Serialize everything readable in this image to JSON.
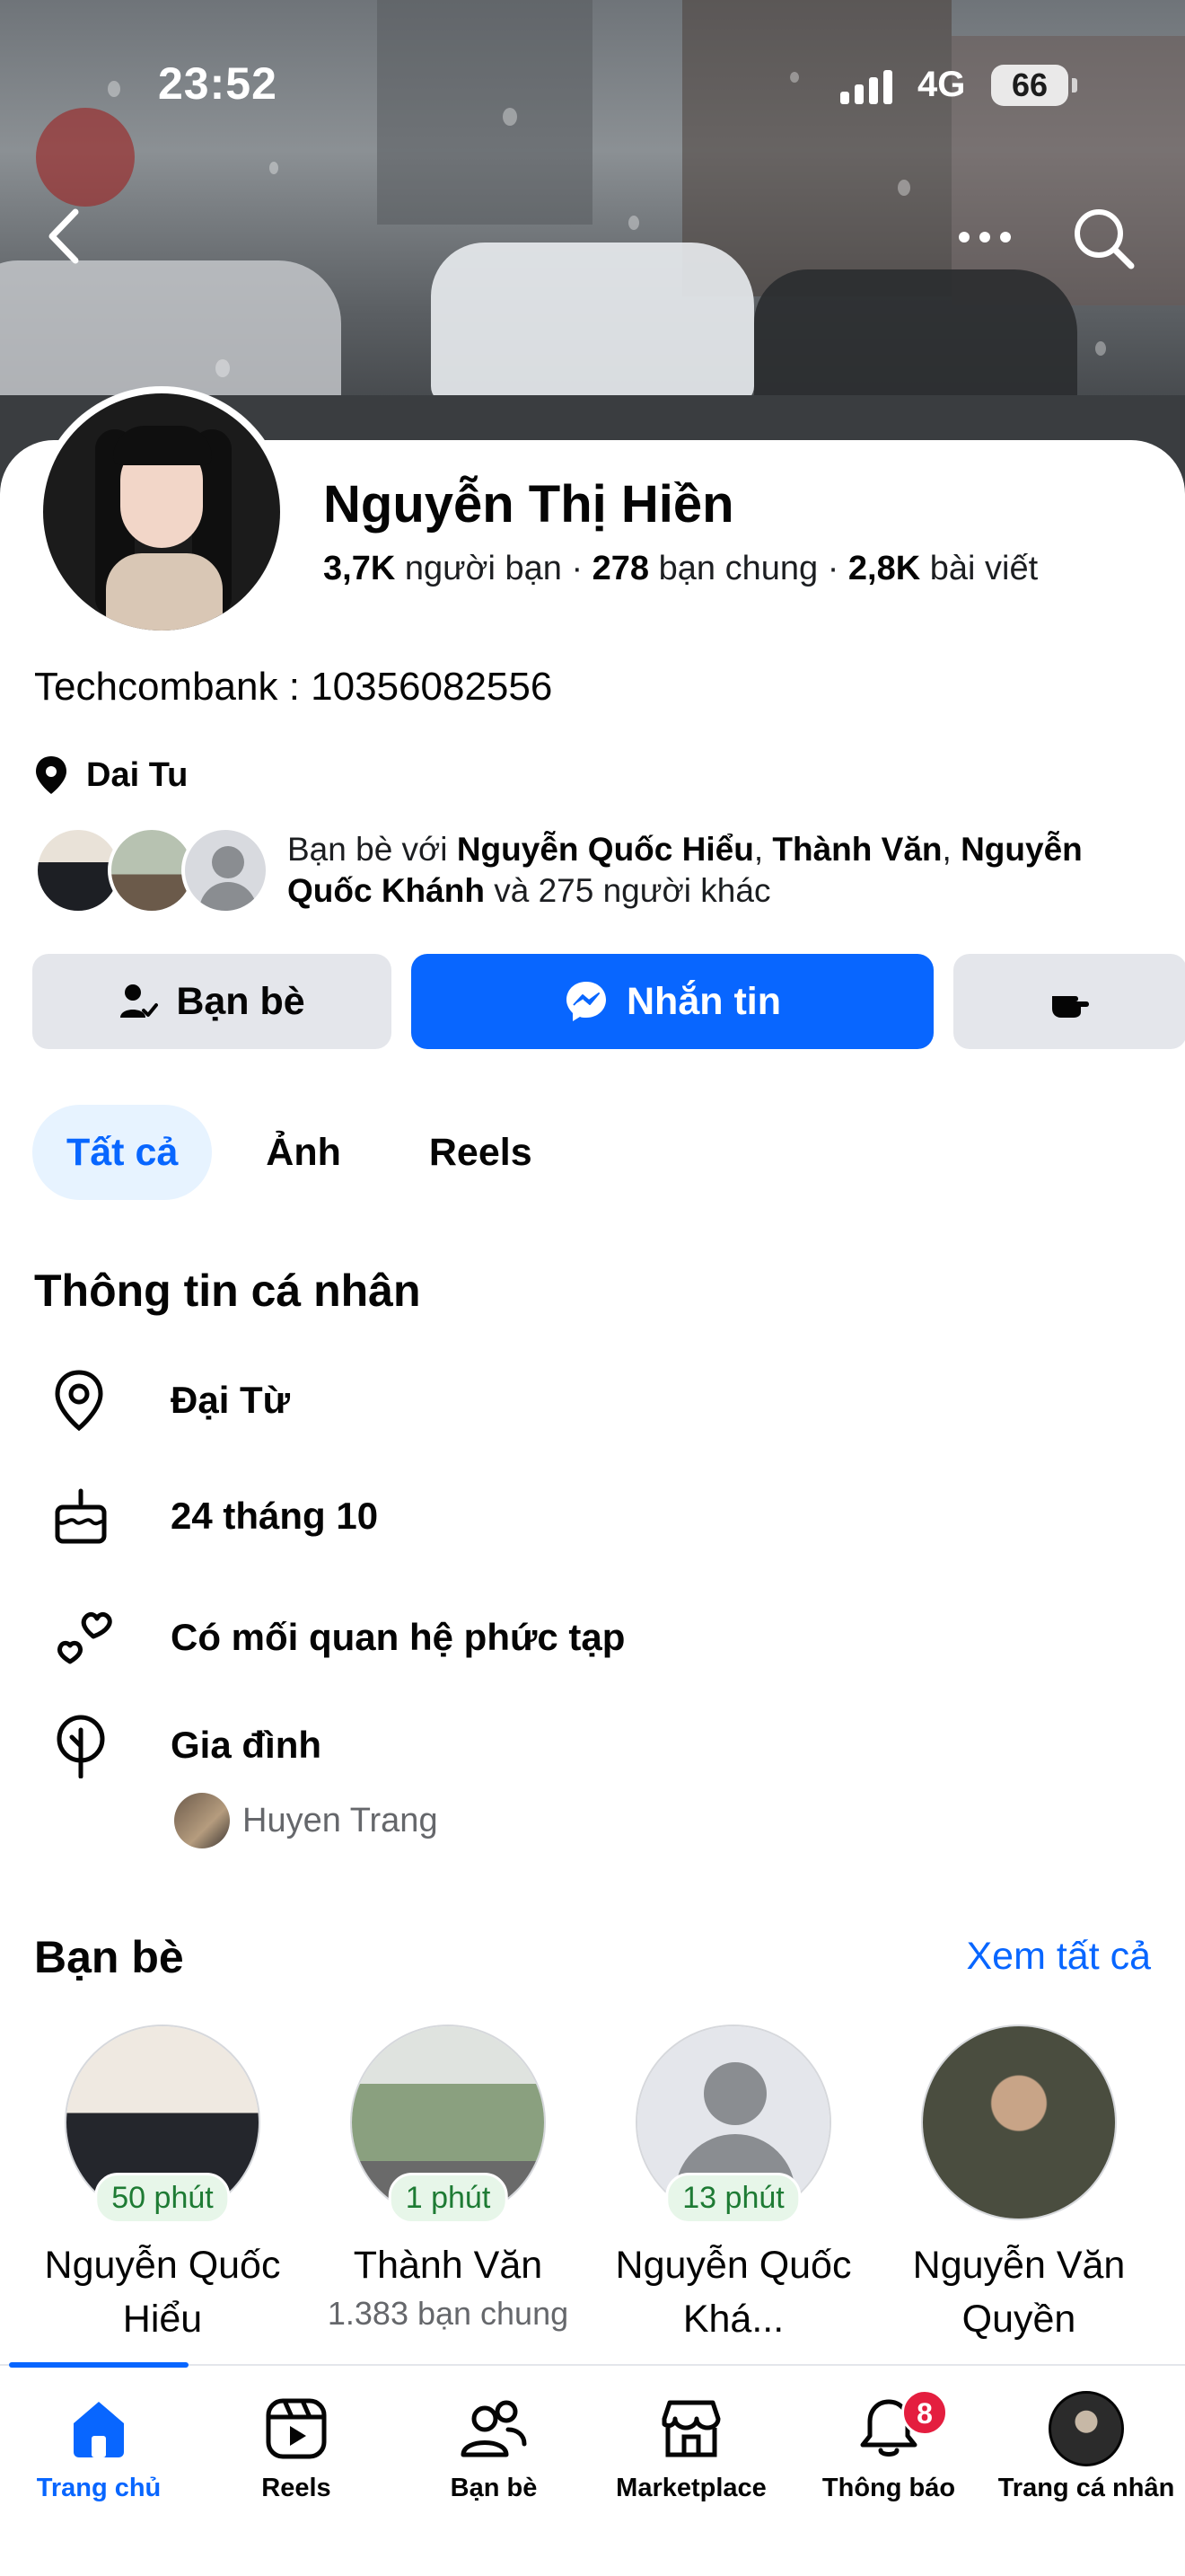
{
  "status_bar": {
    "time": "23:52",
    "network": "4G",
    "battery": "66"
  },
  "profile": {
    "name": "Nguyễn Thị Hiền",
    "stats": [
      {
        "value": "3,7K",
        "label": "người bạn"
      },
      {
        "value": "278",
        "label": "bạn chung"
      },
      {
        "value": "2,8K",
        "label": "bài viết"
      }
    ],
    "bio": "Techcombank : 10356082556",
    "location": "Dai Tu",
    "mutual": {
      "prefix": "Bạn bè với",
      "name1": "Nguyễn Quốc Hiểu",
      "name2": "Thành Văn",
      "name3": "Nguyễn Quốc Khánh",
      "suffix": "và 275 người khác"
    }
  },
  "actions": {
    "friends": "Bạn bè",
    "message": "Nhắn tin"
  },
  "tabs": [
    "Tất cả",
    "Ảnh",
    "Reels"
  ],
  "personal_info": {
    "title": "Thông tin cá nhân",
    "location": "Đại Từ",
    "birthday": "24 tháng 10",
    "relationship": "Có mối quan hệ phức tạp",
    "family_title": "Gia đình",
    "family_member": "Huyen Trang"
  },
  "friends_section": {
    "title": "Bạn bè",
    "see_all": "Xem tất cả",
    "items": [
      {
        "name": "Nguyễn Quốc Hiểu",
        "badge": "50 phút",
        "mutual": ""
      },
      {
        "name": "Thành Văn",
        "badge": "1 phút",
        "mutual": "1.383 bạn chung"
      },
      {
        "name": "Nguyễn Quốc Khá...",
        "badge": "13 phút",
        "mutual": ""
      },
      {
        "name": "Nguyễn Văn Quyền",
        "badge": "",
        "mutual": ""
      }
    ]
  },
  "bottom_nav": {
    "items": [
      "Trang chủ",
      "Reels",
      "Bạn bè",
      "Marketplace",
      "Thông báo",
      "Trang cá nhân"
    ],
    "notifications_count": "8"
  },
  "colors": {
    "accent": "#0866ff",
    "notification": "#e41e3f",
    "badge_text": "#1e7b34"
  }
}
